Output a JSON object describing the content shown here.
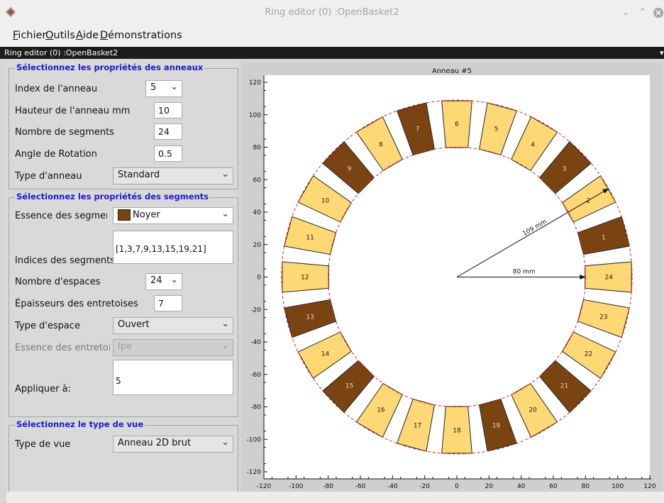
{
  "window": {
    "title": "Ring editor (0) :OpenBasket2"
  },
  "menu": {
    "items": [
      "Fichier",
      "Outils",
      "Aide",
      "Démonstrations"
    ],
    "mnemonics": [
      "F",
      "O",
      "A",
      "D"
    ]
  },
  "doc_tab": {
    "title": "Ring editor (0) :OpenBasket2"
  },
  "ring_props": {
    "title": "Sélectionnez les propriétés des anneaux",
    "index_label": "Index de l'anneau",
    "index_value": "5",
    "height_label": "Hauteur de l'anneau mm",
    "height_value": "10",
    "segments_label": "Nombre de segments",
    "segments_value": "24",
    "rotation_label": "Angle de Rotation",
    "rotation_value": "0.5",
    "type_label": "Type d'anneau",
    "type_value": "Standard"
  },
  "segment_props": {
    "title": "Sélectionnez les propriétés des segments",
    "wood_label": "Essence des segments",
    "wood_value": "Noyer",
    "indices_label": "Indices des segments",
    "indices_value": "[1,3,7,9,13,15,19,21]",
    "spaces_label": "Nombre d'espaces",
    "spaces_value": "24",
    "spacer_thickness_label": "Épaisseurs des entretoises",
    "spacer_thickness_value": "7",
    "space_type_label": "Type d'espace",
    "space_type_value": "Ouvert",
    "spacer_wood_label": "Essence des entretoises",
    "spacer_wood_value": "Ipe",
    "apply_label": "Appliquer à:",
    "apply_value": "5"
  },
  "view_props": {
    "title": "Sélectionnez le type de vue",
    "view_label": "Type de vue",
    "view_value": "Anneau 2D brut"
  },
  "colors": {
    "walnut": "#7a4412",
    "maple": "#fdd874",
    "outline": "#222222",
    "guide": "#e02020",
    "accent": "#1a1acd"
  },
  "chart_data": {
    "type": "diagram",
    "title": "Anneau #5",
    "xlim": [
      -120,
      120
    ],
    "ylim": [
      -120,
      120
    ],
    "xticks": [
      -120,
      -100,
      -80,
      -60,
      -40,
      -20,
      0,
      20,
      40,
      60,
      80,
      100,
      120
    ],
    "yticks": [
      -120,
      -100,
      -80,
      -60,
      -40,
      -20,
      0,
      20,
      40,
      60,
      80,
      100,
      120
    ],
    "segment_count": 24,
    "inner_radius": 80,
    "outer_radius": 109,
    "rotation_deg": 0.5,
    "dark_segments": [
      1,
      3,
      7,
      9,
      13,
      15,
      19,
      21
    ],
    "segment_labels": [
      "1",
      "2",
      "3",
      "4",
      "5",
      "6",
      "7",
      "8",
      "9",
      "10",
      "11",
      "12",
      "13",
      "14",
      "15",
      "16",
      "17",
      "18",
      "19",
      "20",
      "21",
      "22",
      "23",
      "24"
    ],
    "annotations": [
      {
        "text": "109 mm",
        "radius": 109,
        "angle_deg": 30
      },
      {
        "text": "80 mm",
        "radius": 80,
        "angle_deg": 0
      }
    ]
  }
}
